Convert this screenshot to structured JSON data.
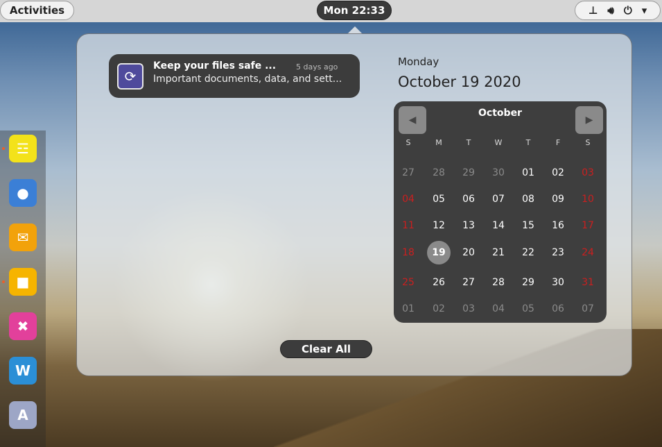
{
  "topbar": {
    "activities": "Activities",
    "clock": "Mon 22:33",
    "sys_icons": {
      "network": "network-icon",
      "volume": "volume-icon",
      "power": "power-icon",
      "chevron": "chevron-down-icon"
    }
  },
  "dock": {
    "apps": [
      {
        "name": "sound-mixer-app",
        "glyph": "☲",
        "color": "#f3e21a",
        "running": true
      },
      {
        "name": "firefox-app",
        "glyph": "●",
        "color": "#3b7fd6",
        "running": false
      },
      {
        "name": "mail-app",
        "glyph": "✉",
        "color": "#f2a20b",
        "running": false
      },
      {
        "name": "files-app",
        "glyph": "■",
        "color": "#f6b400",
        "running": true
      },
      {
        "name": "x-app",
        "glyph": "✖",
        "color": "#e2409b",
        "running": false
      },
      {
        "name": "word-app",
        "glyph": "W",
        "color": "#2b8fd6",
        "running": false
      },
      {
        "name": "text-editor-app",
        "glyph": "A",
        "color": "#9da6c6",
        "running": false
      }
    ]
  },
  "notification": {
    "icon": "refresh-icon",
    "title": "Keep your files safe ...",
    "time": "5 days ago",
    "body": "Important documents, data, and sett..."
  },
  "date": {
    "day": "Monday",
    "full": "October 19 2020"
  },
  "calendar": {
    "month": "October",
    "weekdays": [
      "S",
      "M",
      "T",
      "W",
      "T",
      "F",
      "S"
    ],
    "weeks": [
      [
        "27",
        "28",
        "29",
        "30",
        "01",
        "02",
        "03"
      ],
      [
        "04",
        "05",
        "06",
        "07",
        "08",
        "09",
        "10"
      ],
      [
        "11",
        "12",
        "13",
        "14",
        "15",
        "16",
        "17"
      ],
      [
        "18",
        "19",
        "20",
        "21",
        "22",
        "23",
        "24"
      ],
      [
        "25",
        "26",
        "27",
        "28",
        "29",
        "30",
        "31"
      ],
      [
        "01",
        "02",
        "03",
        "04",
        "05",
        "06",
        "07"
      ]
    ],
    "today": "19",
    "prev_icon": "chevron-left-icon",
    "next_icon": "chevron-right-icon"
  },
  "clear_all": "Clear All",
  "colors": {
    "weekend": "#cc1f1f",
    "accent_today": "#8a8a8a"
  }
}
